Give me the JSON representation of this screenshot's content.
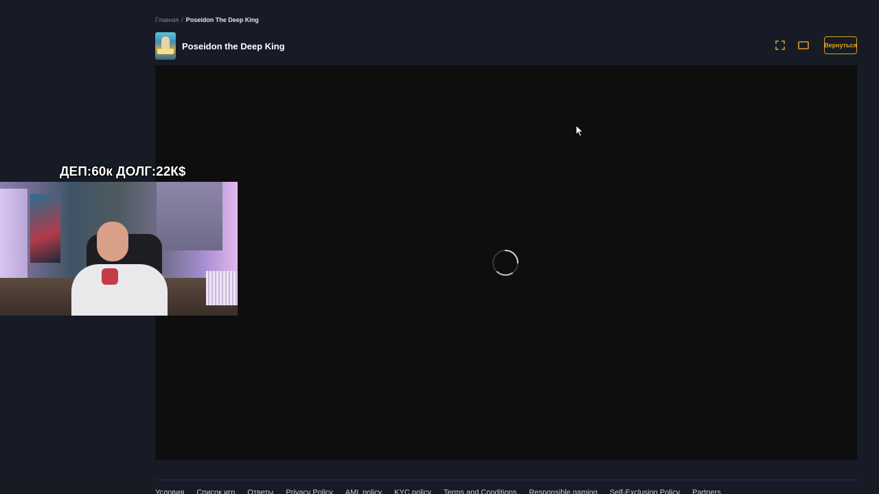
{
  "breadcrumb": {
    "home": "Главная",
    "separator": "/",
    "current": "Poseidon The Deep King"
  },
  "game": {
    "title": "Poseidon the Deep King",
    "thumbnail_icon": "game-thumbnail"
  },
  "controls": {
    "fullscreen_icon": "fullscreen-icon",
    "theater_icon": "theater-mode-icon",
    "return_label": "Вернуться",
    "accent_color": "#e0a020"
  },
  "frame": {
    "loading_icon": "loading-spinner-icon",
    "background_color": "#0e0e0f"
  },
  "stream_overlay": {
    "label": "ДЕП:60к ДОЛГ:22К$"
  },
  "footer": {
    "links": [
      "Условия",
      "Список игр",
      "Ответы",
      "Privacy Policy",
      "AML policy",
      "KYC policy",
      "Terms and Conditions",
      "Responsible gaming",
      "Self-Exclusion Policy",
      "Partners"
    ]
  },
  "colors": {
    "page_background": "#161b26"
  }
}
